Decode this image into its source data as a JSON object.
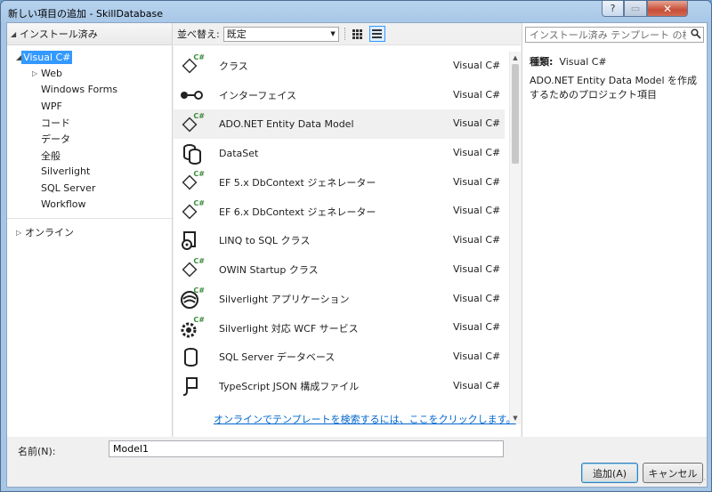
{
  "window": {
    "title": "新しい項目の追加 - SkillDatabase",
    "help_label": "?",
    "close_label": "✕"
  },
  "tree": {
    "root": {
      "label": "インストール済み"
    },
    "selected": {
      "label": "Visual C#"
    },
    "children": [
      {
        "label": "Web"
      },
      {
        "label": "Windows Forms"
      },
      {
        "label": "WPF"
      },
      {
        "label": "コード"
      },
      {
        "label": "データ"
      },
      {
        "label": "全般"
      },
      {
        "label": "Silverlight"
      },
      {
        "label": "SQL Server"
      },
      {
        "label": "Workflow"
      }
    ],
    "online": {
      "label": "オンライン"
    }
  },
  "toolbar": {
    "sort_label": "並べ替え:",
    "sort_value": "既定"
  },
  "templates": [
    {
      "name": "クラス",
      "lang": "Visual C#",
      "icon": "class-icon"
    },
    {
      "name": "インターフェイス",
      "lang": "Visual C#",
      "icon": "interface-icon"
    },
    {
      "name": "ADO.NET Entity Data Model",
      "lang": "Visual C#",
      "icon": "entity-model-icon"
    },
    {
      "name": "DataSet",
      "lang": "Visual C#",
      "icon": "dataset-icon"
    },
    {
      "name": "EF 5.x DbContext ジェネレーター",
      "lang": "Visual C#",
      "icon": "ef-generator-icon"
    },
    {
      "name": "EF 6.x DbContext ジェネレーター",
      "lang": "Visual C#",
      "icon": "ef-generator-icon"
    },
    {
      "name": "LINQ to SQL クラス",
      "lang": "Visual C#",
      "icon": "linq-icon"
    },
    {
      "name": "OWIN Startup クラス",
      "lang": "Visual C#",
      "icon": "owin-class-icon"
    },
    {
      "name": "Silverlight アプリケーション",
      "lang": "Visual C#",
      "icon": "silverlight-icon"
    },
    {
      "name": "Silverlight 対応 WCF サービス",
      "lang": "Visual C#",
      "icon": "wcf-service-icon"
    },
    {
      "name": "SQL Server データベース",
      "lang": "Visual C#",
      "icon": "database-icon"
    },
    {
      "name": "TypeScript JSON 構成ファイル",
      "lang": "Visual C#",
      "icon": "json-config-icon"
    }
  ],
  "online_link": "オンラインでテンプレートを検索するには、ここをクリックします。",
  "search": {
    "placeholder": "インストール済み テンプレート の検索"
  },
  "details": {
    "type_label": "種類:",
    "type_value": "Visual C#",
    "description": "ADO.NET Entity Data Model を作成するためのプロジェクト項目"
  },
  "bottom": {
    "name_label": "名前(N):",
    "name_value": "Model1",
    "add_label": "追加(A)",
    "cancel_label": "キャンセル"
  }
}
